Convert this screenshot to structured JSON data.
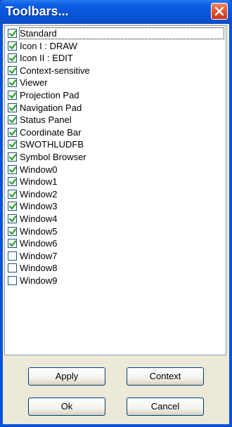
{
  "window": {
    "title": "Toolbars..."
  },
  "toolbars": [
    {
      "label": "Standard",
      "checked": true
    },
    {
      "label": "Icon I : DRAW",
      "checked": true
    },
    {
      "label": "Icon II : EDIT",
      "checked": true
    },
    {
      "label": "Context-sensitive",
      "checked": true
    },
    {
      "label": "Viewer",
      "checked": true
    },
    {
      "label": "Projection Pad",
      "checked": true
    },
    {
      "label": "Navigation Pad",
      "checked": true
    },
    {
      "label": "Status Panel",
      "checked": true
    },
    {
      "label": "Coordinate Bar",
      "checked": true
    },
    {
      "label": "SWOTHLUDFB",
      "checked": true
    },
    {
      "label": "Symbol Browser",
      "checked": true
    },
    {
      "label": "Window0",
      "checked": true
    },
    {
      "label": "Window1",
      "checked": true
    },
    {
      "label": "Window2",
      "checked": true
    },
    {
      "label": "Window3",
      "checked": true
    },
    {
      "label": "Window4",
      "checked": true
    },
    {
      "label": "Window5",
      "checked": true
    },
    {
      "label": "Window6",
      "checked": true
    },
    {
      "label": "Window7",
      "checked": false
    },
    {
      "label": "Window8",
      "checked": false
    },
    {
      "label": "Window9",
      "checked": false
    }
  ],
  "buttons": {
    "apply": "Apply",
    "context": "Context",
    "ok": "Ok",
    "cancel": "Cancel"
  },
  "colors": {
    "titlebar": "#0a54d6",
    "close": "#e0502c",
    "check": "#21a121",
    "panel": "#ece9d8"
  }
}
